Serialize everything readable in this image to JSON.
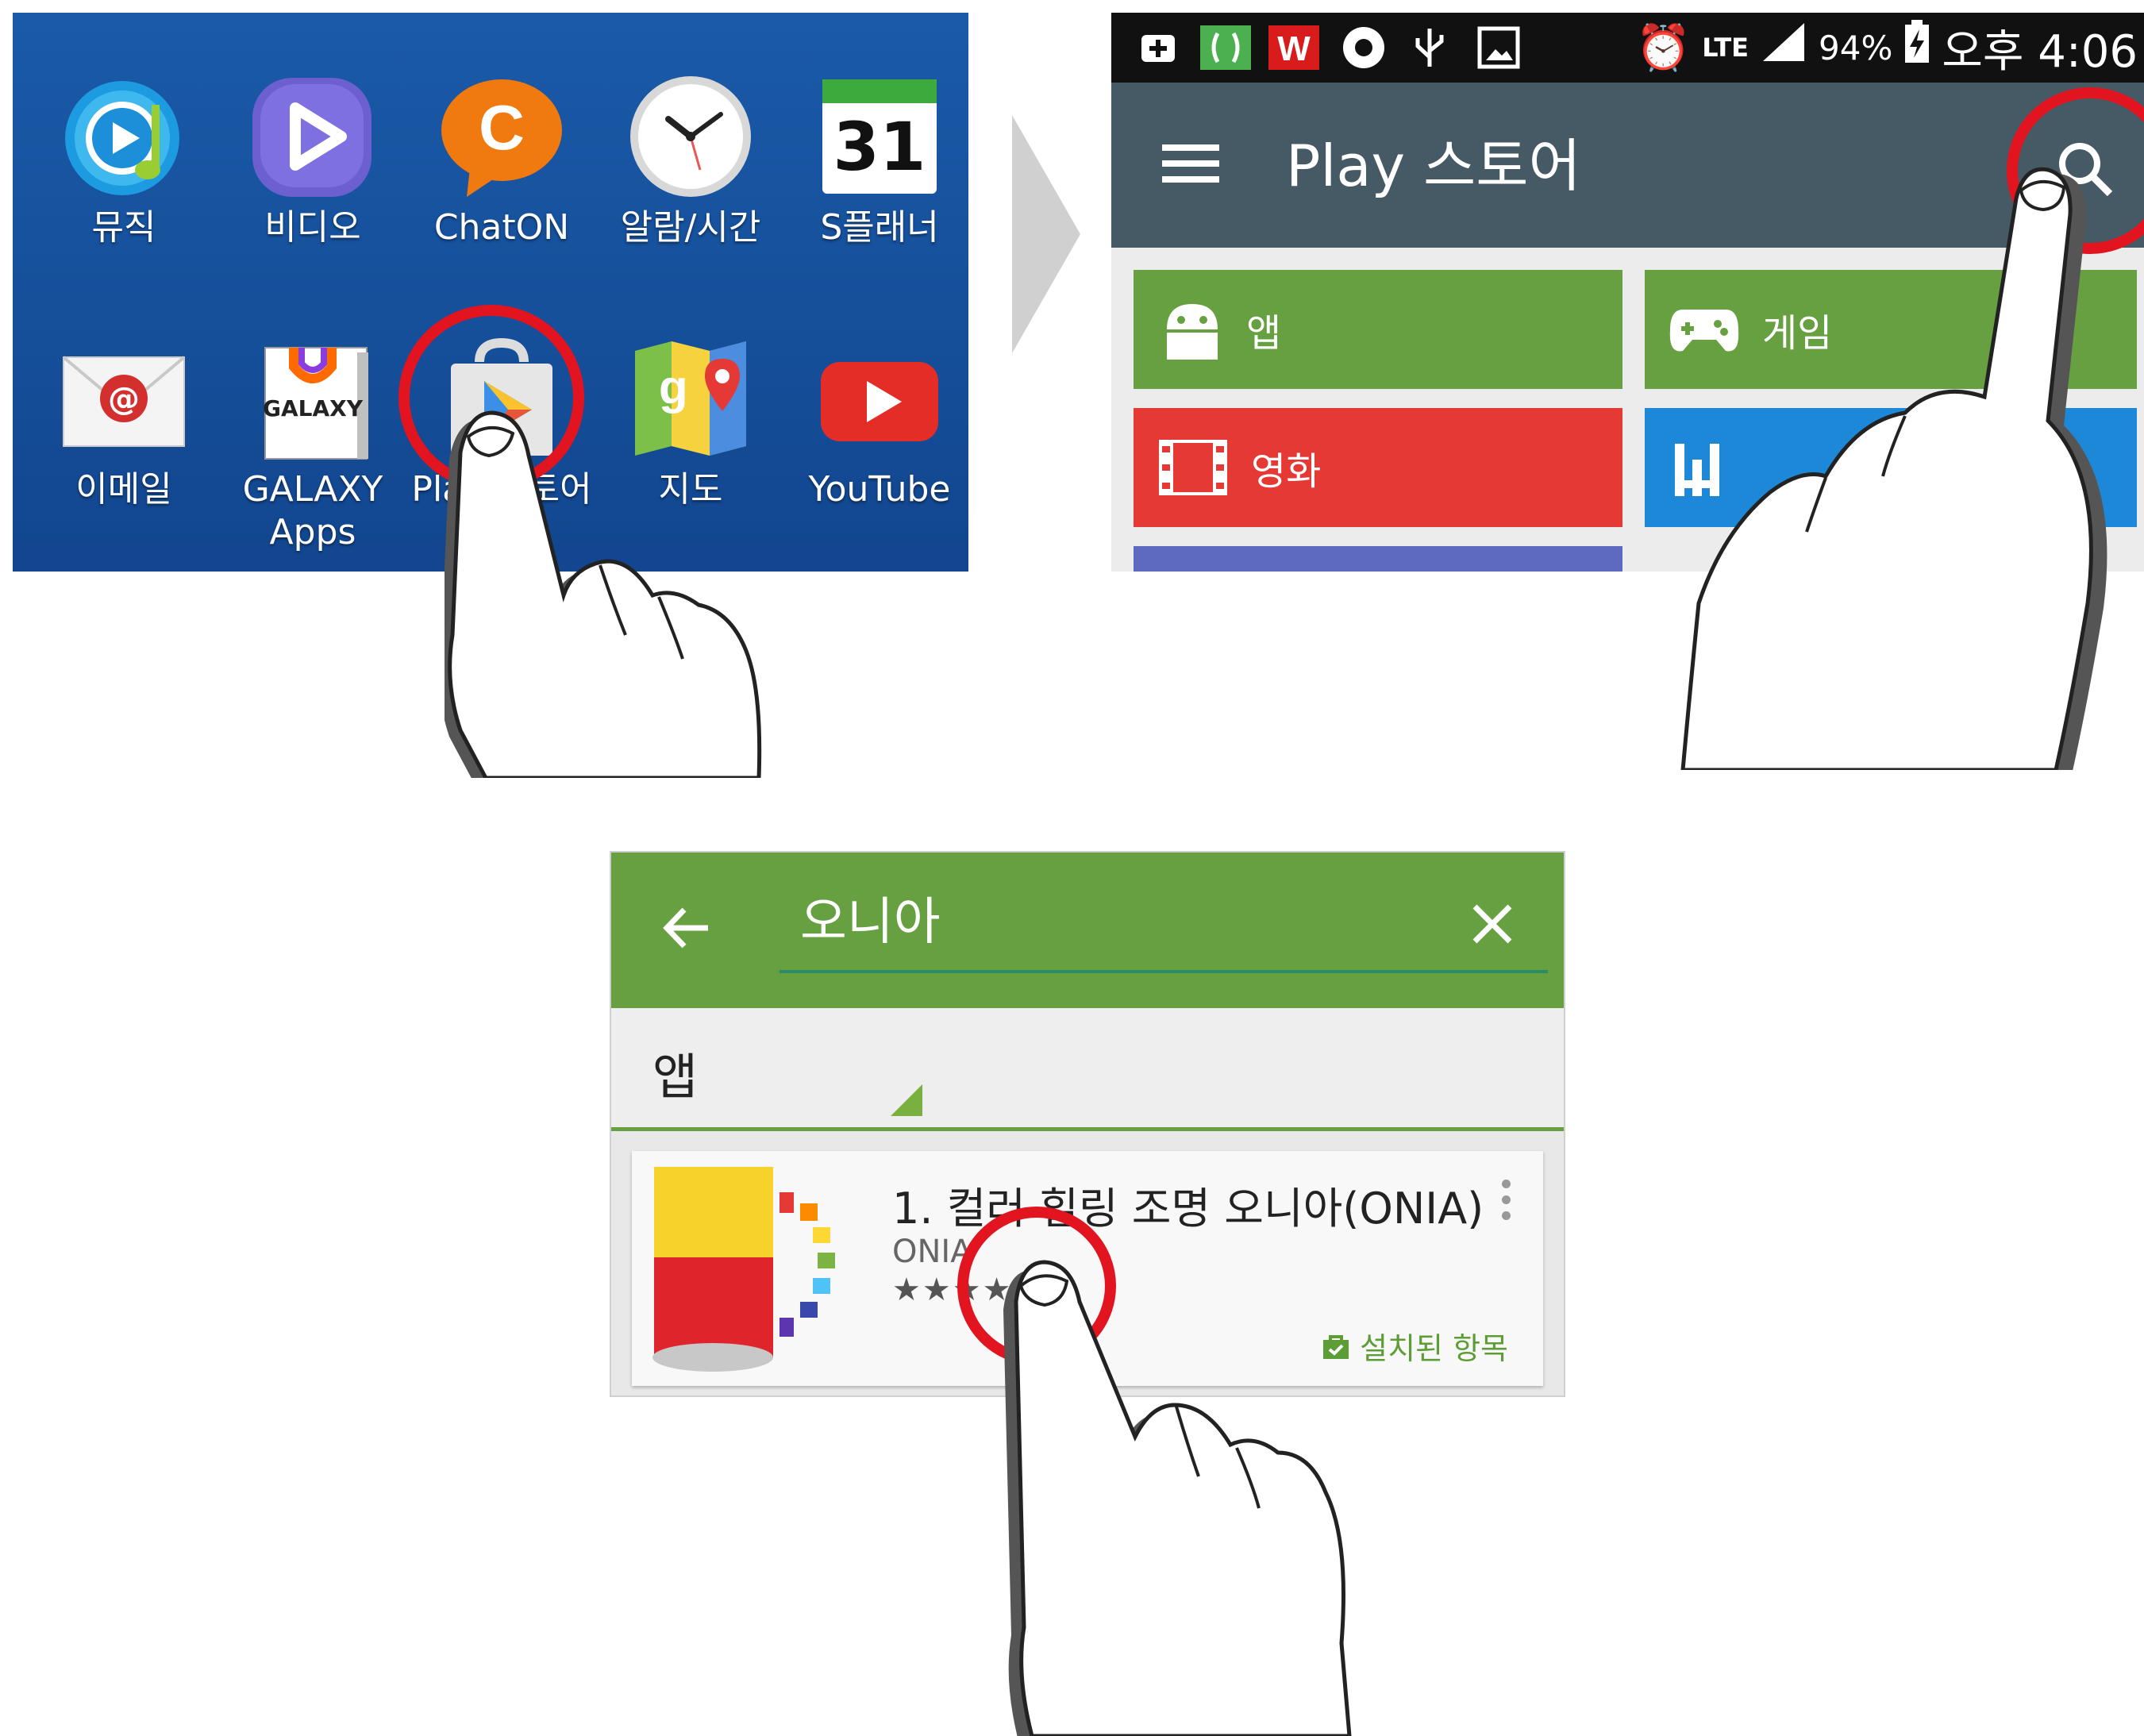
{
  "home_screen": {
    "apps": [
      {
        "label": "뮤직",
        "icon": "music-icon"
      },
      {
        "label": "비디오",
        "icon": "video-icon"
      },
      {
        "label": "ChatON",
        "icon": "chaton-icon"
      },
      {
        "label": "알람/시간",
        "icon": "clock-icon"
      },
      {
        "label": "S플래너",
        "icon": "calendar-icon",
        "icon_text": "31"
      },
      {
        "label": "이메일",
        "icon": "email-icon"
      },
      {
        "label": "GALAXY\nApps",
        "icon": "galaxy-apps-icon",
        "icon_text": "GALAXY"
      },
      {
        "label": "Play 스토어",
        "icon": "play-store-icon",
        "highlighted": true
      },
      {
        "label": "지도",
        "icon": "maps-icon"
      },
      {
        "label": "YouTube",
        "icon": "youtube-icon"
      }
    ]
  },
  "play_store": {
    "status_bar": {
      "battery": "94%",
      "time": "오후 4:06",
      "network": "LTE"
    },
    "title": "Play 스토어",
    "categories": [
      {
        "label": "앱",
        "color": "#66a040",
        "icon": "android-icon"
      },
      {
        "label": "게임",
        "color": "#66a040",
        "icon": "gamepad-icon"
      },
      {
        "label": "영화",
        "color": "#e53935",
        "icon": "film-icon"
      },
      {
        "label": "",
        "color": "#1e88d8",
        "icon": "music-bars-icon"
      }
    ]
  },
  "search_results": {
    "query": "오니아",
    "section_title": "앱",
    "result": {
      "title": "1. 컬러 힐링 조명 오니아(ONIA)",
      "developer": "ONIA",
      "rating_stars": "★★★★★",
      "installed_label": "설치된 항목"
    }
  },
  "colors": {
    "home_bg": "#15509a",
    "toolbar": "#455a64",
    "green": "#66a040",
    "red_ring": "#e1141f"
  }
}
